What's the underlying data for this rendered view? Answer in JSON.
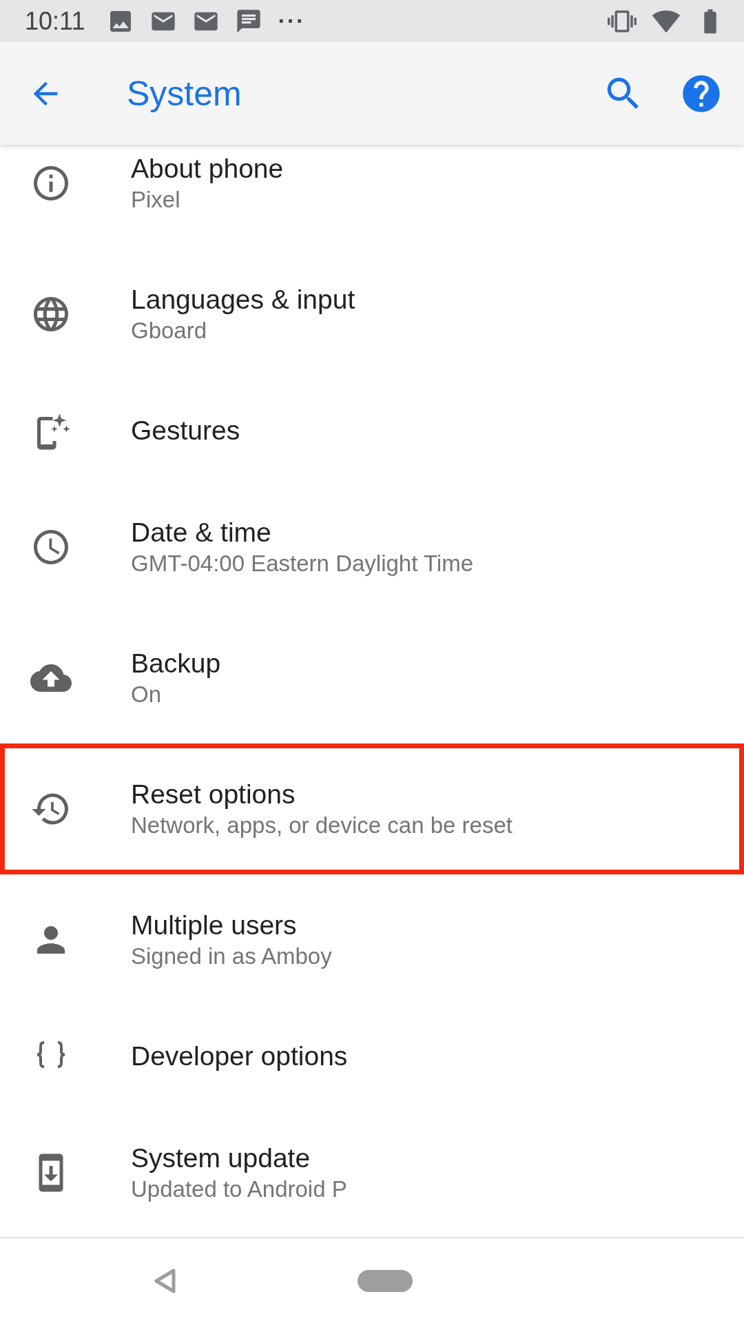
{
  "status_bar": {
    "time": "10:11",
    "overflow": "···"
  },
  "app_bar": {
    "title": "System"
  },
  "items": [
    {
      "title": "About phone",
      "subtitle": "Pixel",
      "highlighted": false
    },
    {
      "title": "Languages & input",
      "subtitle": "Gboard",
      "highlighted": false
    },
    {
      "title": "Gestures",
      "highlighted": false
    },
    {
      "title": "Date & time",
      "subtitle": "GMT-04:00 Eastern Daylight Time",
      "highlighted": false
    },
    {
      "title": "Backup",
      "subtitle": "On",
      "highlighted": false
    },
    {
      "title": "Reset options",
      "subtitle": "Network, apps, or device can be reset",
      "highlighted": true
    },
    {
      "title": "Multiple users",
      "subtitle": "Signed in as Amboy",
      "highlighted": false
    },
    {
      "title": "Developer options",
      "highlighted": false
    },
    {
      "title": "System update",
      "subtitle": "Updated to Android P",
      "highlighted": false
    }
  ]
}
